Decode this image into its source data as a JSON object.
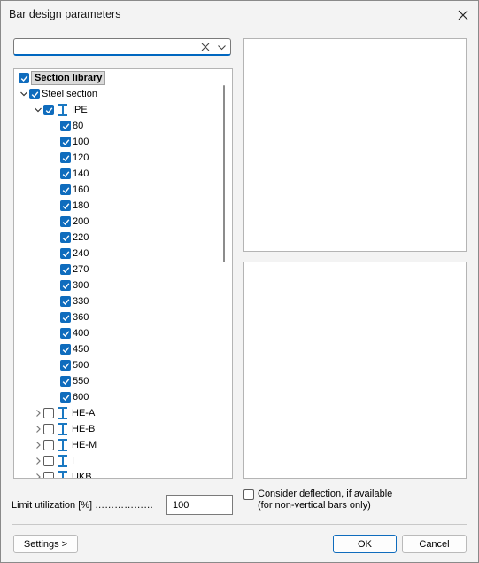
{
  "window": {
    "title": "Bar design parameters"
  },
  "search": {
    "value": "",
    "placeholder": ""
  },
  "tree": {
    "root_label": "Section library",
    "steel_label": "Steel section",
    "ipe_label": "IPE",
    "ipe_sizes": [
      "80",
      "100",
      "120",
      "140",
      "160",
      "180",
      "200",
      "220",
      "240",
      "270",
      "300",
      "330",
      "360",
      "400",
      "450",
      "500",
      "550",
      "600"
    ],
    "collapsed_groups": [
      "HE-A",
      "HE-B",
      "HE-M",
      "I",
      "UKB"
    ]
  },
  "limit": {
    "label": "Limit utilization [%] ………………",
    "value": "100"
  },
  "deflection": {
    "line1": "Consider deflection, if available",
    "line2": "(for non-vertical bars only)",
    "checked": false
  },
  "buttons": {
    "settings": "Settings >",
    "ok": "OK",
    "cancel": "Cancel"
  },
  "colors": {
    "accent": "#0f6cbd",
    "ibeam": "#1a78c2"
  }
}
